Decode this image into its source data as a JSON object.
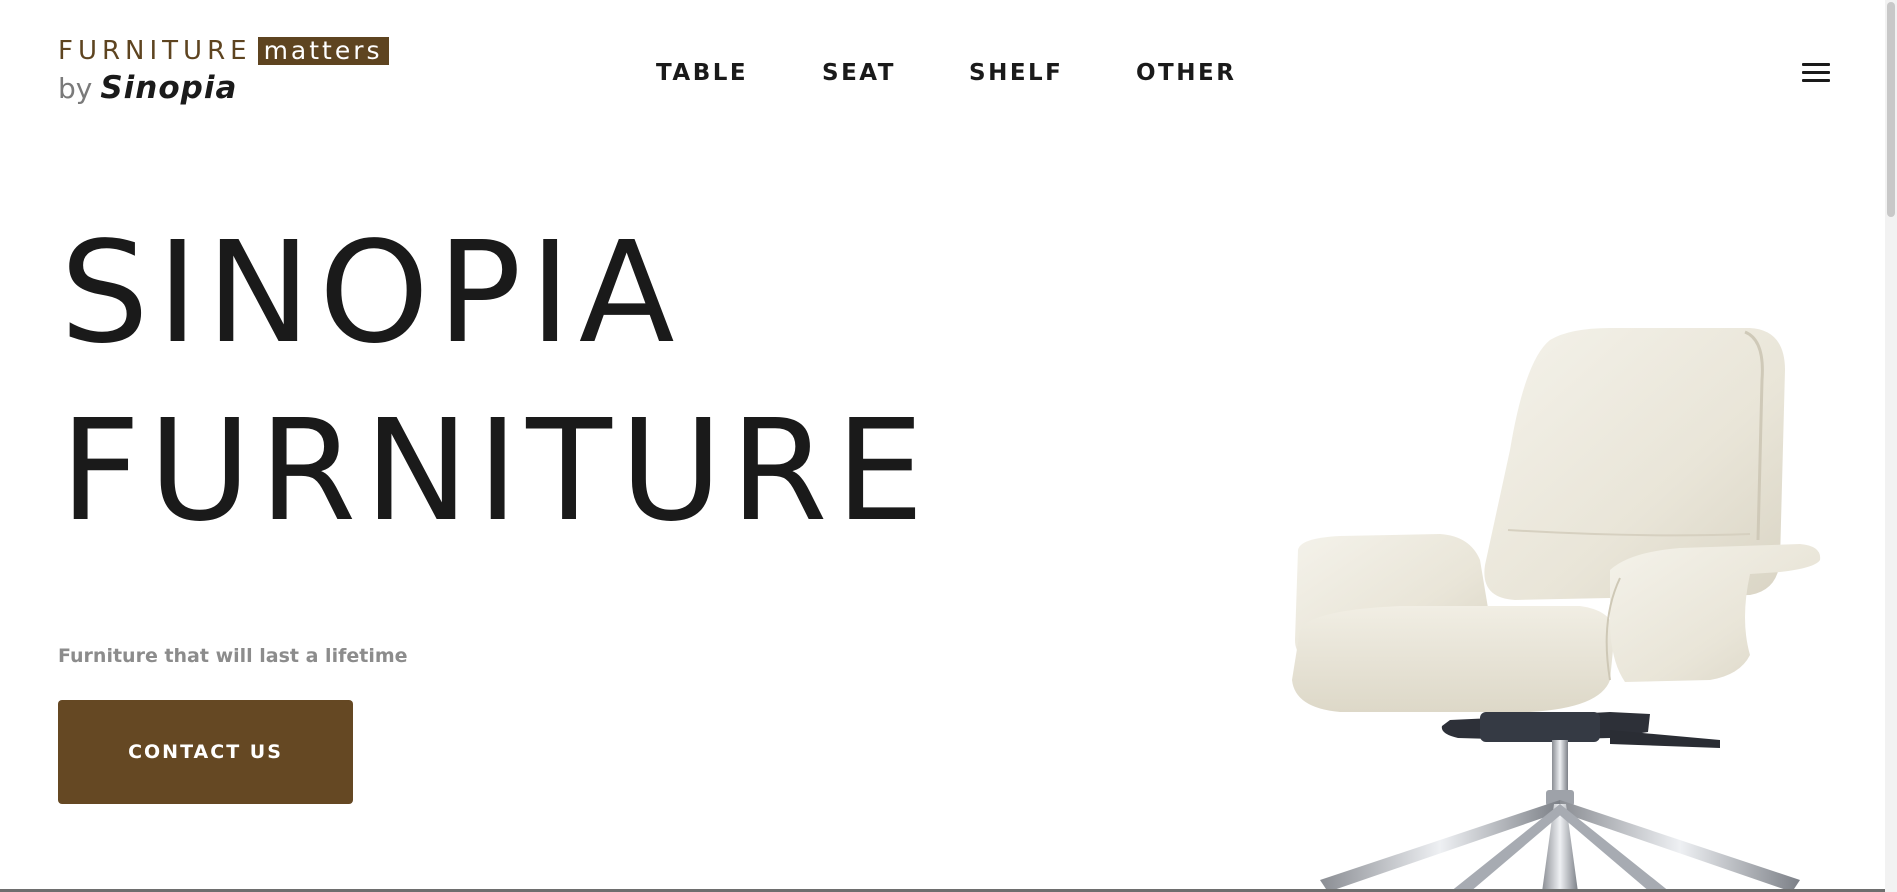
{
  "brand": {
    "line1_word": "FURNITURE",
    "line1_badge": "matters",
    "line2_prefix": "by",
    "line2_name": "Sinopia",
    "brand_color": "#5e4420"
  },
  "nav": {
    "items": [
      {
        "label": "TABLE"
      },
      {
        "label": "SEAT"
      },
      {
        "label": "SHELF"
      },
      {
        "label": "OTHER"
      }
    ],
    "menu_icon": "hamburger-menu-icon"
  },
  "hero": {
    "title_line1": "SINOPIA",
    "title_line2": "FURNITURE",
    "tagline": "Furniture that will last a lifetime",
    "cta_label": "CONTACT US",
    "cta_color": "#654823",
    "image_subject": "office-chair"
  }
}
